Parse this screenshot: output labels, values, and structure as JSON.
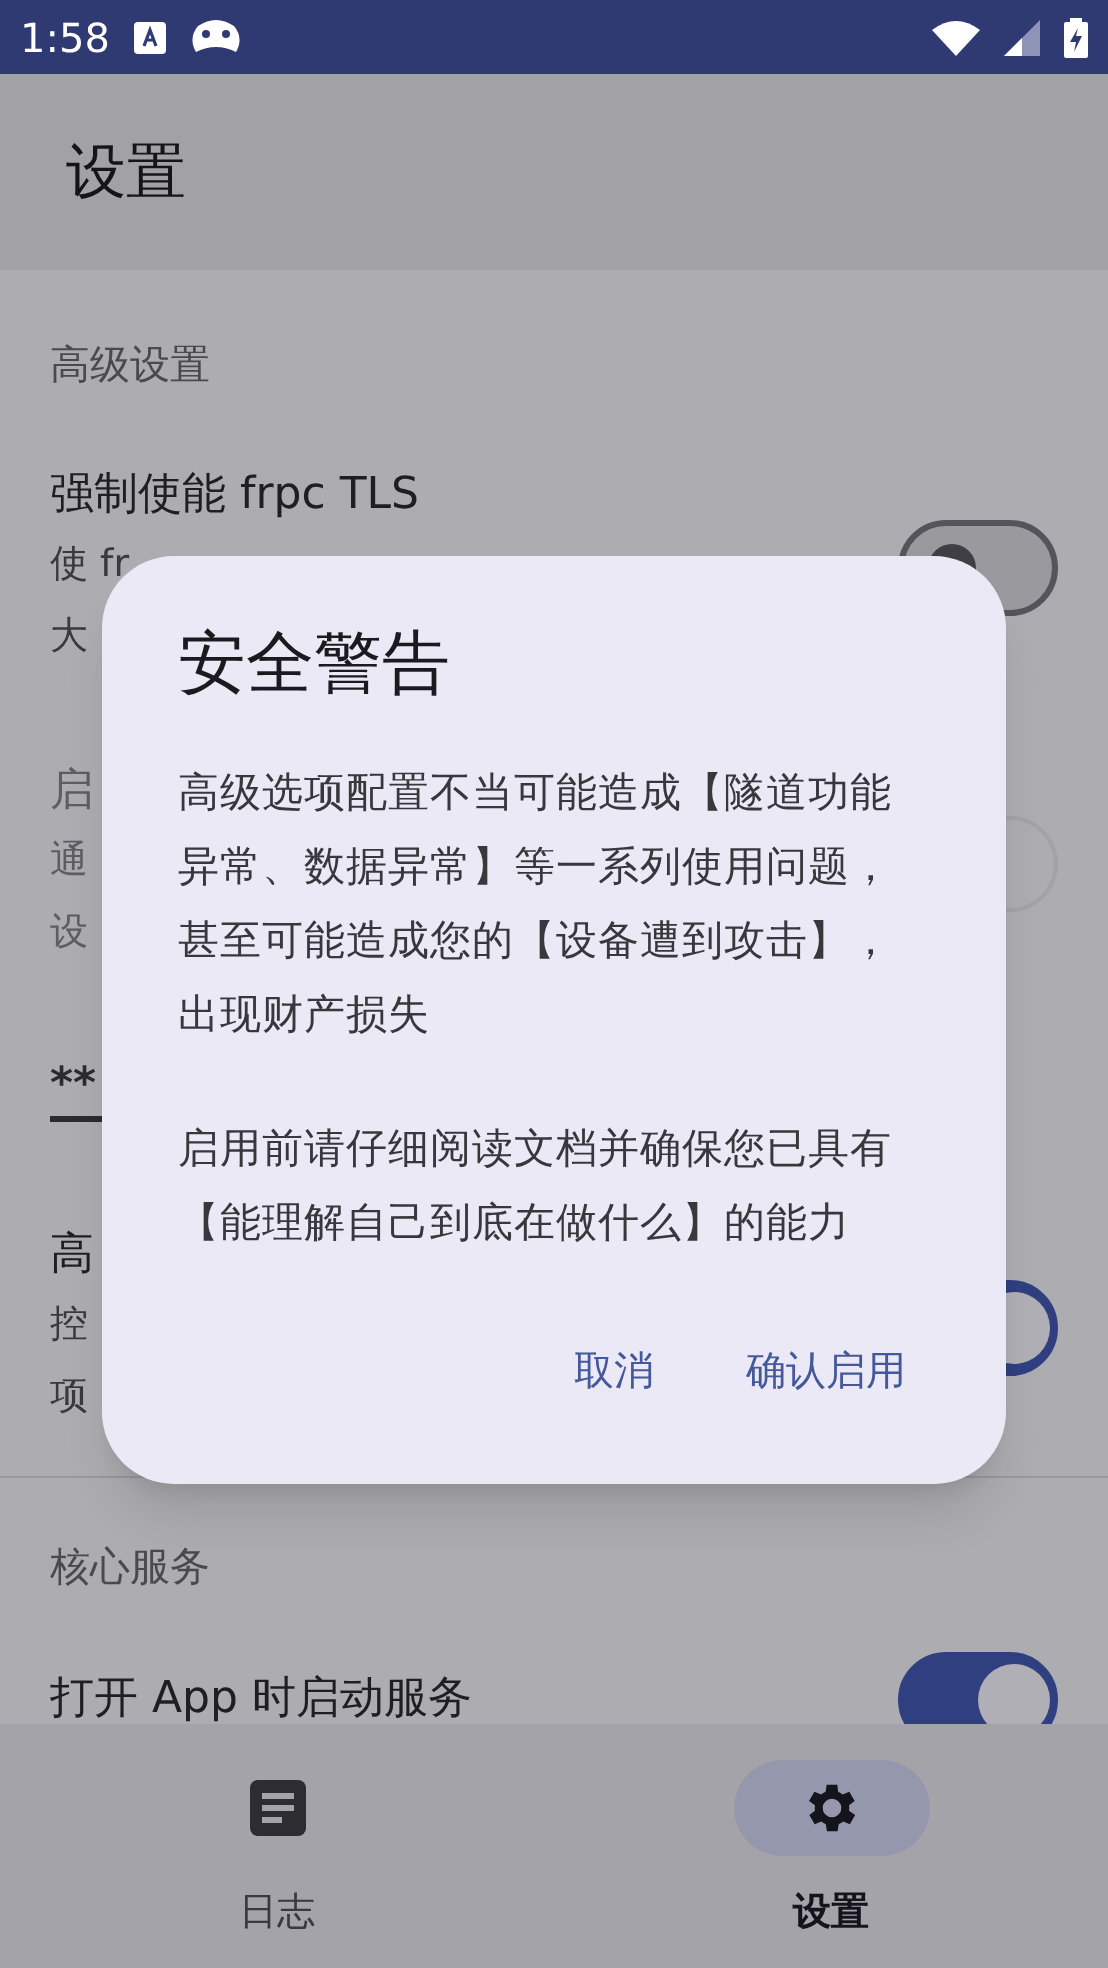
{
  "status_bar": {
    "time": "1:58"
  },
  "app_bar": {
    "title": "设置"
  },
  "sections": [
    {
      "header": "高级设置",
      "rows": [
        {
          "kind": "switch",
          "title": "强制使能 frpc TLS",
          "subtitle": [
            "使 fr",
            "大"
          ],
          "on": false,
          "disabled": false
        },
        {
          "kind": "switch",
          "title": "启",
          "subtitle": [
            "通",
            "设"
          ],
          "on": false,
          "disabled": true
        },
        {
          "kind": "field",
          "value": "**"
        },
        {
          "kind": "switch",
          "title": "高",
          "subtitle": [
            "控",
            "项"
          ],
          "on": true,
          "disabled": false
        }
      ]
    },
    {
      "header": "核心服务",
      "rows": [
        {
          "kind": "switch",
          "title": "打开 App 时启动服务",
          "on": true,
          "disabled": false
        }
      ]
    }
  ],
  "dialog": {
    "title": "安全警告",
    "paragraphs": [
      "高级选项配置不当可能造成【隧道功能异常、数据异常】等一系列使用问题，甚至可能造成您的【设备遭到攻击】，出现财产损失",
      "启用前请仔细阅读文档并确保您已具有【能理解自己到底在做什么】的能力"
    ],
    "buttons": [
      "取消",
      "确认启用"
    ]
  },
  "bottom_nav": [
    {
      "label": "日志",
      "selected": false
    },
    {
      "label": "设置",
      "selected": true
    }
  ]
}
